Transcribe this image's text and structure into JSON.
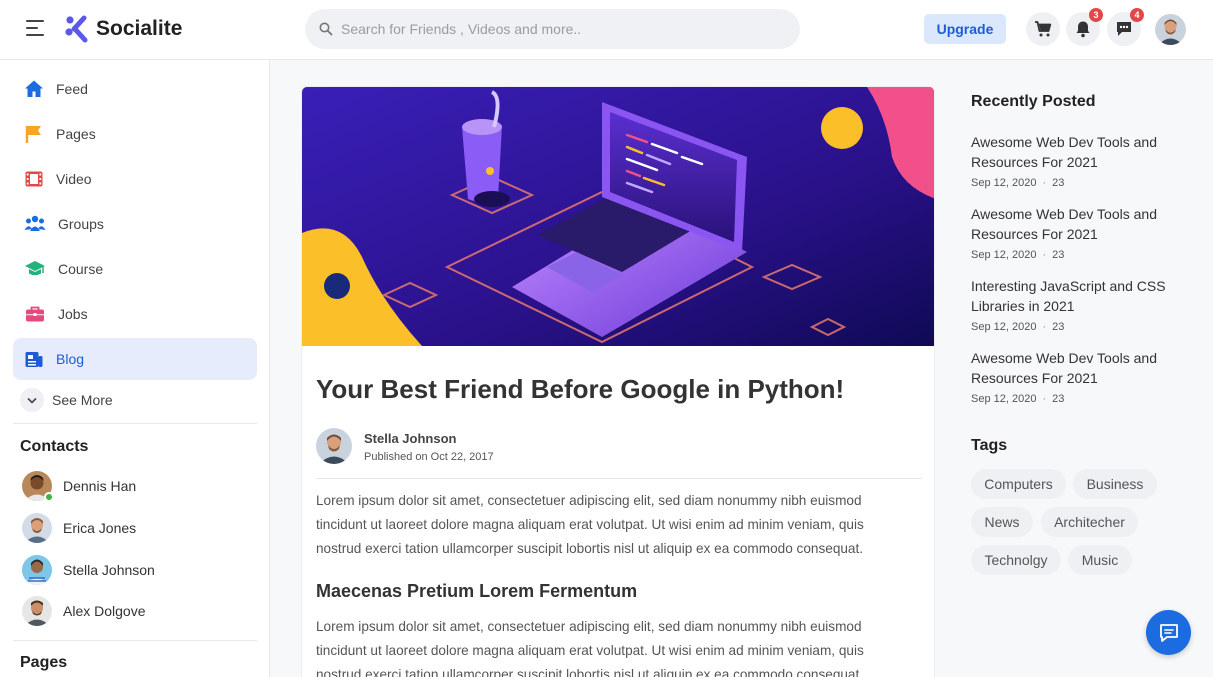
{
  "app": {
    "name": "Socialite"
  },
  "header": {
    "search_placeholder": "Search for Friends , Videos and more..",
    "upgrade_label": "Upgrade",
    "notifications_count": "3",
    "messages_count": "4"
  },
  "sidebar": {
    "items": [
      {
        "label": "Feed",
        "icon": "home-icon",
        "color": "#1d6be0"
      },
      {
        "label": "Pages",
        "icon": "flag-icon",
        "color": "#f5a623"
      },
      {
        "label": "Video",
        "icon": "film-icon",
        "color": "#e24848"
      },
      {
        "label": "Groups",
        "icon": "users-icon",
        "color": "#1d6be0"
      },
      {
        "label": "Course",
        "icon": "graduation-cap-icon",
        "color": "#23b27a"
      },
      {
        "label": "Jobs",
        "icon": "briefcase-icon",
        "color": "#e6497c"
      },
      {
        "label": "Blog",
        "icon": "newspaper-icon",
        "color": "#1d5cd6"
      }
    ],
    "see_more": "See More",
    "contacts_title": "Contacts",
    "contacts": [
      {
        "name": "Dennis Han"
      },
      {
        "name": "Erica Jones"
      },
      {
        "name": "Stella Johnson"
      },
      {
        "name": "Alex Dolgove"
      }
    ],
    "pages_title": "Pages"
  },
  "post": {
    "title": "Your Best Friend Before Google in Python!",
    "author": "Stella Johnson",
    "published": "Published on Oct 22, 2017",
    "para1": "Lorem ipsum dolor sit amet, consectetuer adipiscing elit, sed diam nonummy nibh euismod tincidunt ut laoreet dolore magna aliquam erat volutpat. Ut wisi enim ad minim veniam, quis nostrud exerci tation ullamcorper suscipit lobortis nisl ut aliquip ex ea commodo consequat.",
    "subheading": "Maecenas Pretium Lorem Fermentum",
    "para2": "Lorem ipsum dolor sit amet, consectetuer adipiscing elit, sed diam nonummy nibh euismod tincidunt ut laoreet dolore magna aliquam erat volutpat. Ut wisi enim ad minim veniam, quis nostrud exerci tation ullamcorper suscipit lobortis nisl ut aliquip ex ea commodo consequat."
  },
  "recent": {
    "title": "Recently Posted",
    "posts": [
      {
        "title": "Awesome Web Dev Tools and Resources For 2021",
        "date": "Sep 12, 2020",
        "count": "23"
      },
      {
        "title": "Awesome Web Dev Tools and Resources For 2021",
        "date": "Sep 12, 2020",
        "count": "23"
      },
      {
        "title": "Interesting JavaScript and CSS Libraries in 2021",
        "date": "Sep 12, 2020",
        "count": "23"
      },
      {
        "title": "Awesome Web Dev Tools and Resources For 2021",
        "date": "Sep 12, 2020",
        "count": "23"
      }
    ]
  },
  "tags": {
    "title": "Tags",
    "items": [
      "Computers",
      "Business",
      "News",
      "Architecher",
      "Technolgy",
      "Music"
    ]
  }
}
